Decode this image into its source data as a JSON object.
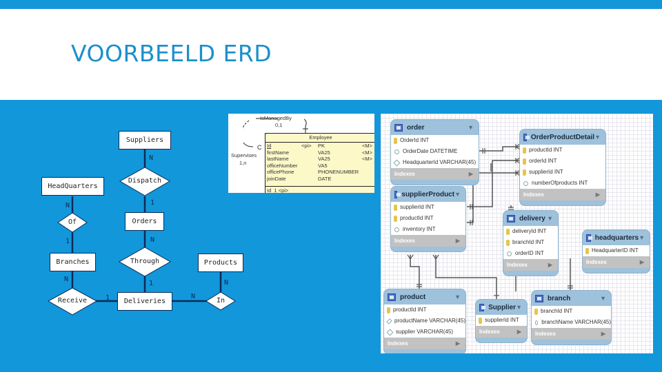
{
  "slide": {
    "title": "VOORBEELD ERD",
    "colors": {
      "accent": "#1497d8",
      "title": "#1b8fcc",
      "panel": "#1297db"
    }
  },
  "chen_erd": {
    "entities": {
      "suppliers": "Suppliers",
      "headquarters": "HeadQuarters",
      "orders": "Orders",
      "branches": "Branches",
      "products": "Products",
      "deliveries": "Deliveries"
    },
    "relationships": {
      "dispatch": "Dispatch",
      "of": "Of",
      "through": "Through",
      "receive": "Receive",
      "in": "In"
    },
    "cardinalities": {
      "suppliers_dispatch": "N",
      "dispatch_orders": "1",
      "hq_of": "N",
      "of_branches": "1",
      "orders_through": "N",
      "through_deliveries": "1",
      "branches_receive": "N",
      "receive_deliveries": "1",
      "deliveries_in": "N",
      "products_in": "N"
    }
  },
  "employee_diagram": {
    "self_relation": "IsManagedBy",
    "self_cardinality_top": "0,1",
    "self_relation_bottom": "Supervises",
    "self_cardinality_bottom": "1,n",
    "marker": "C",
    "entity": "Employee",
    "columns": [
      {
        "name": "Id",
        "tag": "<pi>",
        "type": "PK",
        "flag": "<M>"
      },
      {
        "name": "firstName",
        "tag": "",
        "type": "VA25",
        "flag": "<M>"
      },
      {
        "name": "lastName",
        "tag": "",
        "type": "VA25",
        "flag": "<M>"
      },
      {
        "name": "officeNumber",
        "tag": "",
        "type": "VA5",
        "flag": ""
      },
      {
        "name": "officePhone",
        "tag": "",
        "type": "PHONENUMBER",
        "flag": ""
      },
      {
        "name": "joinDate",
        "tag": "",
        "type": "DATE",
        "flag": ""
      }
    ],
    "identifier": "Id_1 <pi>"
  },
  "workbench": {
    "indexes_label": "Indexes",
    "tables": {
      "order": {
        "name": "order",
        "columns": [
          {
            "icon": "key",
            "text": "OrderId INT"
          },
          {
            "icon": "circle",
            "text": "OrderDate DATETIME"
          },
          {
            "icon": "diamond",
            "text": "HeadquarterId VARCHAR(45)"
          }
        ]
      },
      "orderProductDetail": {
        "name": "OrderProductDetail",
        "columns": [
          {
            "icon": "key",
            "text": "productId INT"
          },
          {
            "icon": "key",
            "text": "orderId INT"
          },
          {
            "icon": "key",
            "text": "supplierId INT"
          },
          {
            "icon": "circle",
            "text": "numberOfproducts INT"
          }
        ]
      },
      "supplierProduct": {
        "name": "supplierProduct",
        "columns": [
          {
            "icon": "key",
            "text": "supplierId INT"
          },
          {
            "icon": "key",
            "text": "productId INT"
          },
          {
            "icon": "circle",
            "text": "inventory INT"
          }
        ]
      },
      "delivery": {
        "name": "delivery",
        "columns": [
          {
            "icon": "key",
            "text": "deliveryId INT"
          },
          {
            "icon": "key",
            "text": "branchId INT"
          },
          {
            "icon": "circle",
            "text": "orderID INT"
          }
        ]
      },
      "headquarters": {
        "name": "headquarters",
        "columns": [
          {
            "icon": "key",
            "text": "HeadquarterID INT"
          }
        ]
      },
      "product": {
        "name": "product",
        "columns": [
          {
            "icon": "key",
            "text": "productId INT"
          },
          {
            "icon": "diamond",
            "text": "productName VARCHAR(45)"
          },
          {
            "icon": "diamond",
            "text": "supplier VARCHAR(45)"
          }
        ]
      },
      "supplier": {
        "name": "Supplier",
        "columns": [
          {
            "icon": "key",
            "text": "supplierId INT"
          }
        ]
      },
      "branch": {
        "name": "branch",
        "columns": [
          {
            "icon": "key",
            "text": "branchId INT"
          },
          {
            "icon": "circle",
            "text": "branchName VARCHAR(45)"
          }
        ]
      }
    }
  }
}
